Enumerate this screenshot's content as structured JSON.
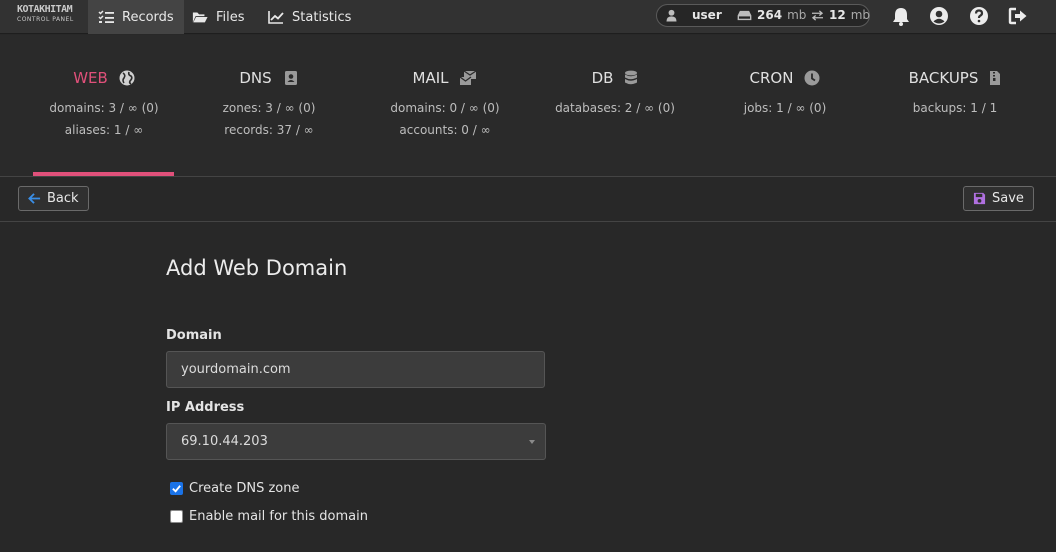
{
  "logo": {
    "line1": "KOTAKHITAM",
    "line2": "CONTROL PANEL"
  },
  "nav": [
    {
      "label": "Records",
      "icon": "list-check-icon",
      "active": true
    },
    {
      "label": "Files",
      "icon": "folder-open-icon",
      "active": false
    },
    {
      "label": "Statistics",
      "icon": "chart-line-icon",
      "active": false
    }
  ],
  "user": {
    "name": "user",
    "disk": "264",
    "disk_unit": "mb",
    "bandwidth": "12",
    "bandwidth_unit": "mb"
  },
  "stats": [
    {
      "title": "WEB",
      "icon": "globe-icon",
      "lines": [
        "domains: 3 / ∞ (0)",
        "aliases: 1 / ∞"
      ],
      "active": true
    },
    {
      "title": "DNS",
      "icon": "address-book-icon",
      "lines": [
        "zones: 3 / ∞ (0)",
        "records: 37 / ∞"
      ],
      "active": false
    },
    {
      "title": "MAIL",
      "icon": "mail-bulk-icon",
      "lines": [
        "domains: 0 / ∞ (0)",
        "accounts: 0 / ∞"
      ],
      "active": false
    },
    {
      "title": "DB",
      "icon": "database-icon",
      "lines": [
        "databases: 2 / ∞ (0)"
      ],
      "active": false
    },
    {
      "title": "CRON",
      "icon": "clock-icon",
      "lines": [
        "jobs: 1 / ∞ (0)"
      ],
      "active": false
    },
    {
      "title": "BACKUPS",
      "icon": "file-archive-icon",
      "lines": [
        "backups: 1 / 1"
      ],
      "active": false
    }
  ],
  "actions": {
    "back_label": "Back",
    "save_label": "Save"
  },
  "form": {
    "title": "Add Web Domain",
    "domain_label": "Domain",
    "domain_placeholder": "yourdomain.com",
    "ip_label": "IP Address",
    "ip_value": "69.10.44.203",
    "dns_label": "Create DNS zone",
    "dns_checked": true,
    "mail_label": "Enable mail for this domain",
    "mail_checked": false
  },
  "colors": {
    "accent": "#e0507a",
    "checkbox": "#1a73e8",
    "save_icon": "#b070e0",
    "back_icon": "#3a8ee6"
  }
}
